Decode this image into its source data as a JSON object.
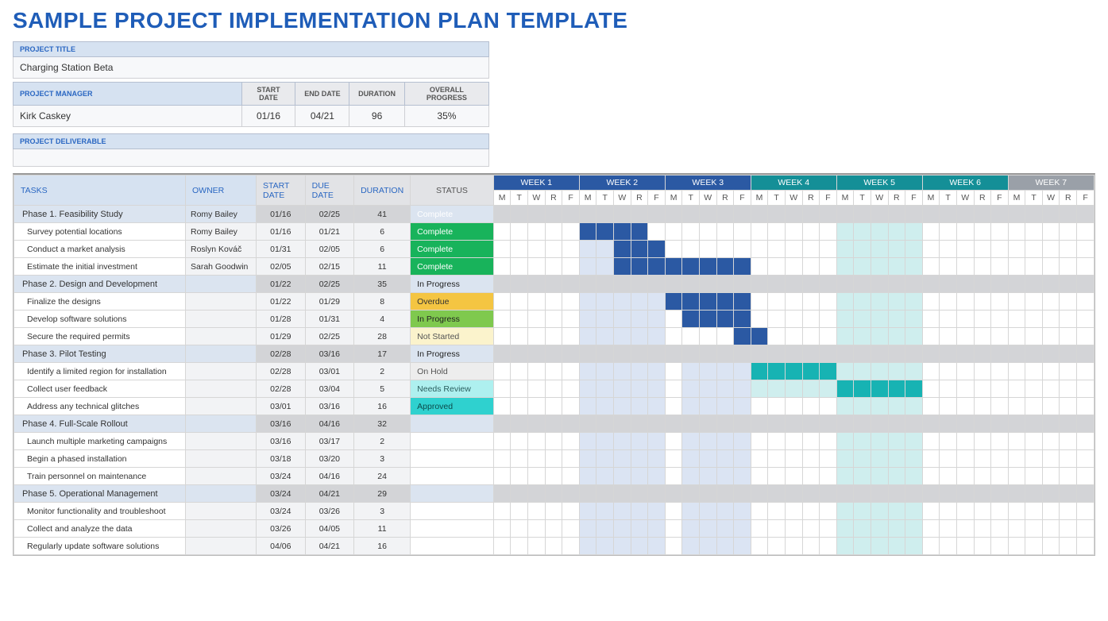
{
  "page_title": "SAMPLE PROJECT IMPLEMENTATION PLAN TEMPLATE",
  "labels": {
    "project_title": "PROJECT TITLE",
    "project_manager": "PROJECT MANAGER",
    "start_date": "START DATE",
    "end_date": "END DATE",
    "duration": "DURATION",
    "overall_progress": "OVERALL PROGRESS",
    "project_deliverable": "PROJECT DELIVERABLE",
    "tasks": "TASKS",
    "owner": "OWNER",
    "due_date": "DUE DATE",
    "status": "STATUS"
  },
  "project": {
    "title": "Charging Station Beta",
    "manager": "Kirk Caskey",
    "start_date": "01/16",
    "end_date": "04/21",
    "duration": "96",
    "overall_progress": "35%",
    "deliverable": ""
  },
  "weeks": [
    {
      "label": "WEEK 1",
      "group": "blue"
    },
    {
      "label": "WEEK 2",
      "group": "blue"
    },
    {
      "label": "WEEK 3",
      "group": "blue"
    },
    {
      "label": "WEEK 4",
      "group": "teal"
    },
    {
      "label": "WEEK 5",
      "group": "teal"
    },
    {
      "label": "WEEK 6",
      "group": "teal"
    },
    {
      "label": "WEEK 7",
      "group": "grey"
    }
  ],
  "dow": [
    "M",
    "T",
    "W",
    "R",
    "F"
  ],
  "rows": [
    {
      "type": "phase",
      "task": "Phase 1.  Feasibility Study",
      "owner": "Romy Bailey",
      "start": "01/16",
      "due": "02/25",
      "dur": "41",
      "status": "Complete",
      "status_class": "st-complete",
      "gantt": []
    },
    {
      "type": "task",
      "task": "Survey potential locations",
      "owner": "Romy Bailey",
      "start": "01/16",
      "due": "01/21",
      "dur": "6",
      "status": "Complete",
      "status_class": "st-complete",
      "gantt": [
        [
          "b-blueS",
          5,
          8
        ],
        [
          "b-blue2",
          20,
          24
        ],
        [
          "b-teal1",
          20,
          24
        ]
      ]
    },
    {
      "type": "task",
      "task": "Conduct a market analysis",
      "owner": "Roslyn Kováč",
      "start": "01/31",
      "due": "02/05",
      "dur": "6",
      "status": "Complete",
      "status_class": "st-complete",
      "gantt": [
        [
          "b-blue2",
          5,
          6
        ],
        [
          "b-blueS",
          7,
          9
        ],
        [
          "b-blue2",
          20,
          24
        ],
        [
          "b-teal1",
          20,
          24
        ]
      ]
    },
    {
      "type": "task",
      "task": "Estimate the initial investment",
      "owner": "Sarah Goodwin",
      "start": "02/05",
      "due": "02/15",
      "dur": "11",
      "status": "Complete",
      "status_class": "st-complete",
      "gantt": [
        [
          "b-blue2",
          5,
          6
        ],
        [
          "b-blueS",
          7,
          14
        ],
        [
          "b-blue2",
          20,
          24
        ],
        [
          "b-teal1",
          20,
          24
        ]
      ]
    },
    {
      "type": "phase",
      "task": "Phase 2.  Design and Development",
      "owner": "",
      "start": "01/22",
      "due": "02/25",
      "dur": "35",
      "status": "In Progress",
      "status_class": "st-in-progress",
      "gantt": []
    },
    {
      "type": "task",
      "task": "Finalize the designs",
      "owner": "",
      "start": "01/22",
      "due": "01/29",
      "dur": "8",
      "status": "Overdue",
      "status_class": "st-overdue",
      "gantt": [
        [
          "b-blue2",
          5,
          9
        ],
        [
          "b-blueS",
          10,
          14
        ],
        [
          "b-blue2",
          20,
          24
        ],
        [
          "b-teal1",
          20,
          24
        ]
      ]
    },
    {
      "type": "task",
      "task": "Develop software solutions",
      "owner": "",
      "start": "01/28",
      "due": "01/31",
      "dur": "4",
      "status": "In Progress",
      "status_class": "st-in-progress",
      "gantt": [
        [
          "b-blue2",
          5,
          9
        ],
        [
          "b-blueS",
          11,
          14
        ],
        [
          "b-blue2",
          20,
          24
        ],
        [
          "b-teal1",
          20,
          24
        ]
      ]
    },
    {
      "type": "task",
      "task": "Secure the required permits",
      "owner": "",
      "start": "01/29",
      "due": "02/25",
      "dur": "28",
      "status": "Not Started",
      "status_class": "st-not-started",
      "gantt": [
        [
          "b-blue2",
          5,
          9
        ],
        [
          "b-blueS",
          14,
          15
        ],
        [
          "b-blue2",
          20,
          24
        ],
        [
          "b-teal1",
          20,
          24
        ]
      ]
    },
    {
      "type": "phase",
      "task": "Phase 3.  Pilot Testing",
      "owner": "",
      "start": "02/28",
      "due": "03/16",
      "dur": "17",
      "status": "In Progress",
      "status_class": "st-in-progress",
      "gantt": []
    },
    {
      "type": "task",
      "task": "Identify a limited region for installation",
      "owner": "",
      "start": "02/28",
      "due": "03/01",
      "dur": "2",
      "status": "On Hold",
      "status_class": "st-on-hold",
      "gantt": [
        [
          "b-blue2",
          5,
          9
        ],
        [
          "b-blue2",
          11,
          14
        ],
        [
          "b-teal4",
          15,
          19
        ],
        [
          "b-teal1",
          20,
          24
        ]
      ]
    },
    {
      "type": "task",
      "task": "Collect user feedback",
      "owner": "",
      "start": "02/28",
      "due": "03/04",
      "dur": "5",
      "status": "Needs Review",
      "status_class": "st-needs-review",
      "gantt": [
        [
          "b-blue2",
          5,
          9
        ],
        [
          "b-blue2",
          11,
          14
        ],
        [
          "b-teal1",
          15,
          19
        ],
        [
          "b-teal4",
          20,
          24
        ]
      ]
    },
    {
      "type": "task",
      "task": "Address any technical glitches",
      "owner": "",
      "start": "03/01",
      "due": "03/16",
      "dur": "16",
      "status": "Approved",
      "status_class": "st-approved",
      "gantt": [
        [
          "b-blue2",
          5,
          9
        ],
        [
          "b-blue2",
          11,
          14
        ],
        [
          "b-teal1",
          20,
          24
        ]
      ]
    },
    {
      "type": "phase",
      "task": "Phase 4.  Full-Scale Rollout",
      "owner": "",
      "start": "03/16",
      "due": "04/16",
      "dur": "32",
      "status": "",
      "status_class": "",
      "gantt": []
    },
    {
      "type": "task",
      "task": "Launch multiple marketing campaigns",
      "owner": "",
      "start": "03/16",
      "due": "03/17",
      "dur": "2",
      "status": "",
      "status_class": "",
      "gantt": [
        [
          "b-blue2",
          5,
          9
        ],
        [
          "b-blue2",
          11,
          14
        ],
        [
          "b-teal1",
          20,
          24
        ]
      ]
    },
    {
      "type": "task",
      "task": "Begin a phased installation",
      "owner": "",
      "start": "03/18",
      "due": "03/20",
      "dur": "3",
      "status": "",
      "status_class": "",
      "gantt": [
        [
          "b-blue2",
          5,
          9
        ],
        [
          "b-blue2",
          11,
          14
        ],
        [
          "b-teal1",
          20,
          24
        ]
      ]
    },
    {
      "type": "task",
      "task": "Train personnel on maintenance",
      "owner": "",
      "start": "03/24",
      "due": "04/16",
      "dur": "24",
      "status": "",
      "status_class": "",
      "gantt": [
        [
          "b-blue2",
          5,
          9
        ],
        [
          "b-blue2",
          11,
          14
        ],
        [
          "b-teal1",
          20,
          24
        ]
      ]
    },
    {
      "type": "phase",
      "task": "Phase 5.  Operational Management",
      "owner": "",
      "start": "03/24",
      "due": "04/21",
      "dur": "29",
      "status": "",
      "status_class": "",
      "gantt": []
    },
    {
      "type": "task",
      "task": "Monitor functionality and troubleshoot",
      "owner": "",
      "start": "03/24",
      "due": "03/26",
      "dur": "3",
      "status": "",
      "status_class": "",
      "gantt": [
        [
          "b-blue2",
          5,
          9
        ],
        [
          "b-blue2",
          11,
          14
        ],
        [
          "b-teal1",
          20,
          24
        ]
      ]
    },
    {
      "type": "task",
      "task": "Collect and analyze the data",
      "owner": "",
      "start": "03/26",
      "due": "04/05",
      "dur": "11",
      "status": "",
      "status_class": "",
      "gantt": [
        [
          "b-blue2",
          5,
          9
        ],
        [
          "b-blue2",
          11,
          14
        ],
        [
          "b-teal1",
          20,
          24
        ]
      ]
    },
    {
      "type": "task",
      "task": "Regularly update software solutions",
      "owner": "",
      "start": "04/06",
      "due": "04/21",
      "dur": "16",
      "status": "",
      "status_class": "",
      "gantt": [
        [
          "b-blue2",
          5,
          9
        ],
        [
          "b-blue2",
          11,
          14
        ],
        [
          "b-teal1",
          20,
          24
        ]
      ]
    }
  ]
}
